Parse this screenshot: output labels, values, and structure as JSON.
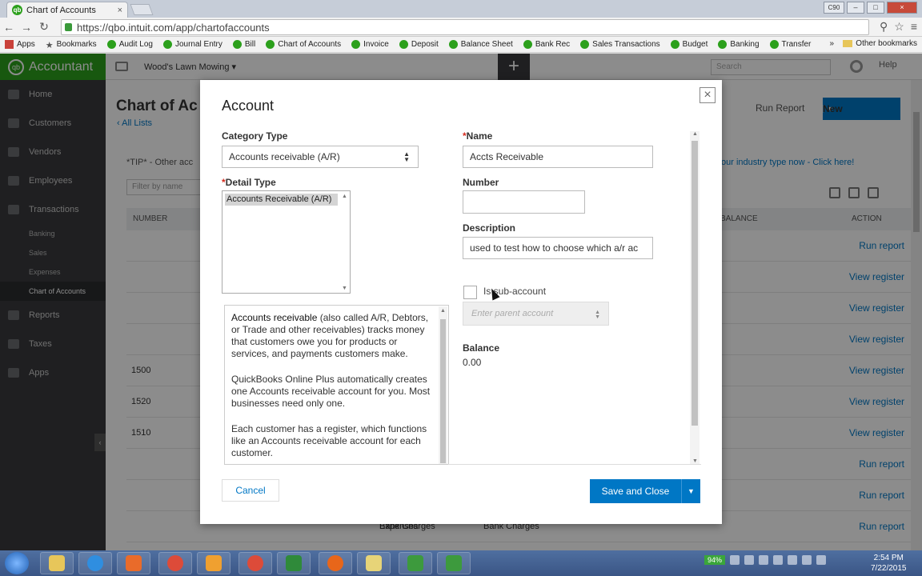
{
  "browser": {
    "tab_title": "Chart of Accounts",
    "tab_close": "×",
    "url": "https://qbo.intuit.com/app/chartofaccounts",
    "bookmarks": [
      "Apps",
      "Bookmarks",
      "Audit Log",
      "Journal Entry",
      "Bill",
      "Chart of Accounts",
      "Invoice",
      "Deposit",
      "Balance Sheet",
      "Bank Rec",
      "Sales Transactions",
      "Budget",
      "Banking",
      "Transfer"
    ],
    "bookmarks_more": "»",
    "other_bookmarks": "Other bookmarks",
    "window_user": "C90"
  },
  "app": {
    "brand": "Accountant",
    "company": "Wood's Lawn Mowing ▾",
    "search_placeholder": "Search",
    "help": "Help",
    "sidebar": {
      "items": [
        "Home",
        "Customers",
        "Vendors",
        "Employees",
        "Transactions"
      ],
      "sub_items": [
        "Banking",
        "Sales",
        "Expenses",
        "Chart of Accounts"
      ],
      "items_after": [
        "Reports",
        "Taxes",
        "Apps"
      ]
    },
    "page": {
      "title": "Chart of Ac",
      "all_lists": "All Lists",
      "run_report": "Run Report",
      "new_label": "New",
      "tip": "*TIP* - Other acc",
      "tip_link": "our industry type now - Click here!",
      "filter_placeholder": "Filter by name",
      "col_number": "NUMBER",
      "col_balance": "BALANCE",
      "col_action": "ACTION"
    },
    "rows": [
      {
        "num": "",
        "a": "",
        "b": "",
        "c": "",
        "action": "Run report"
      },
      {
        "num": "",
        "a": "",
        "b": "",
        "c": "",
        "action": "View register"
      },
      {
        "num": "",
        "a": "",
        "b": "",
        "c": "",
        "action": "View register"
      },
      {
        "num": "",
        "a": "",
        "b": "",
        "c": "",
        "action": "View register"
      },
      {
        "num": "1500",
        "a": "",
        "b": "",
        "c": "",
        "action": "View register"
      },
      {
        "num": "1520",
        "a": "",
        "b": "",
        "c": "",
        "action": "View register"
      },
      {
        "num": "1510",
        "a": "",
        "b": "",
        "c": "",
        "action": "View register"
      },
      {
        "num": "",
        "a": "",
        "b": "",
        "c": "",
        "action": "Run report"
      },
      {
        "num": "",
        "a": "",
        "b": "",
        "c": "",
        "action": "Run report"
      },
      {
        "num": "",
        "a": "Bank Charges",
        "b": "Expenses",
        "c": "Bank Charges",
        "action": "Run report"
      }
    ]
  },
  "modal": {
    "title": "Account",
    "close": "×",
    "category_type_label": "Category Type",
    "category_type_value": "Accounts receivable (A/R)",
    "detail_type_label": "Detail Type",
    "detail_type_option": "Accounts Receivable (A/R)",
    "description_paragraphs": [
      {
        "strong": "Accounts receivable",
        "rest": " (also called A/R, Debtors, or Trade and other receivables) tracks money that customers owe you for products or services, and payments customers make."
      },
      {
        "strong": "",
        "rest": "QuickBooks Online Plus automatically creates one Accounts receivable account for you. Most businesses need only one."
      },
      {
        "strong": "",
        "rest": "Each customer has a register, which functions like an Accounts receivable account for each customer."
      }
    ],
    "name_label": "Name",
    "name_value": "Accts Receivable",
    "number_label": "Number",
    "number_value": "",
    "description_label": "Description",
    "description_value": "used to test how to choose which a/r ac",
    "subaccount_label": "Is sub-account",
    "subaccount_checked": false,
    "parent_placeholder": "Enter parent account",
    "balance_label": "Balance",
    "balance_value": "0.00",
    "cancel": "Cancel",
    "save": "Save and Close"
  },
  "taskbar": {
    "battery": "94%",
    "time": "2:54 PM",
    "date": "7/22/2015"
  }
}
